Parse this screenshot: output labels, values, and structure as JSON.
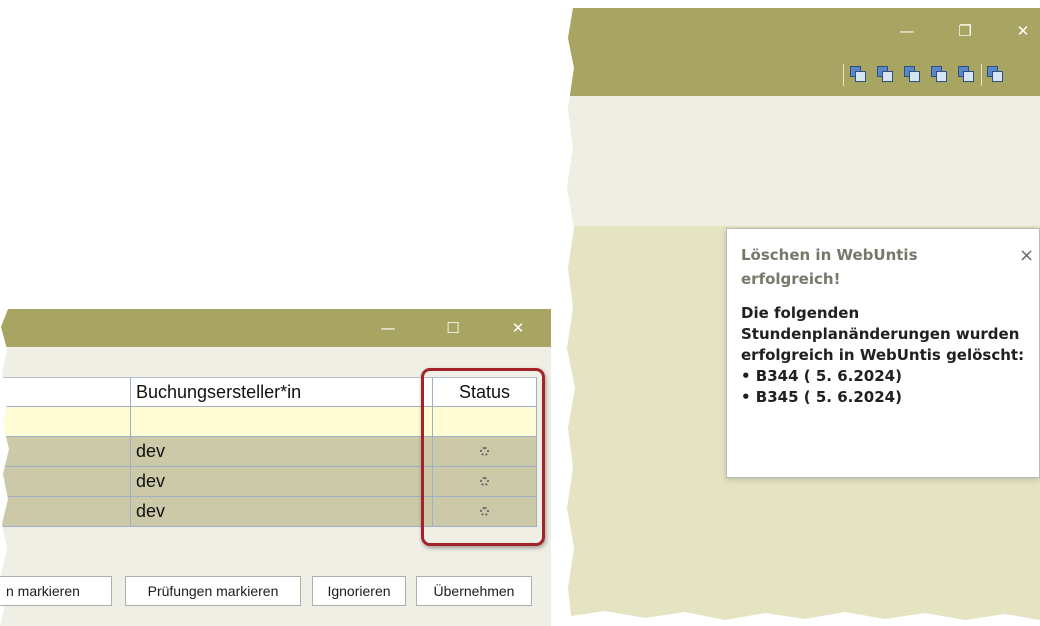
{
  "left_window": {
    "controls": {
      "minimize": "—",
      "maximize": "☐",
      "close": "✕"
    },
    "table": {
      "headers": [
        "",
        "Buchungsersteller*in",
        "Status"
      ],
      "rows": [
        [
          "",
          "dev",
          "loading-spinner"
        ],
        [
          "",
          "dev",
          "loading-spinner"
        ],
        [
          "",
          "dev",
          "loading-spinner"
        ]
      ]
    },
    "buttons": {
      "mark_partial": "n markieren",
      "mark_exams": "Prüfungen markieren",
      "ignore": "Ignorieren",
      "apply": "Übernehmen"
    },
    "highlight_color": "#a2232a"
  },
  "right_window": {
    "controls": {
      "minimize": "—",
      "restore": "❐",
      "close": "✕"
    },
    "toolbar_icons": [
      "window-1-icon",
      "window-2-icon",
      "window-3-icon",
      "window-4-icon",
      "window-5-icon",
      "window-icon"
    ],
    "toast": {
      "title": "Löschen in WebUntis erfolgreich!",
      "close": "×",
      "message": "Die folgenden Stundenplanänderungen wurden erfolgreich in WebUntis gelöscht:",
      "items": [
        "• B344 ( 5. 6.2024)",
        "• B345 ( 5. 6.2024)"
      ]
    }
  },
  "colors": {
    "titlebar": "#a8a462",
    "row_selected": "#cbc9a8",
    "filter_row": "#fffbd5"
  }
}
